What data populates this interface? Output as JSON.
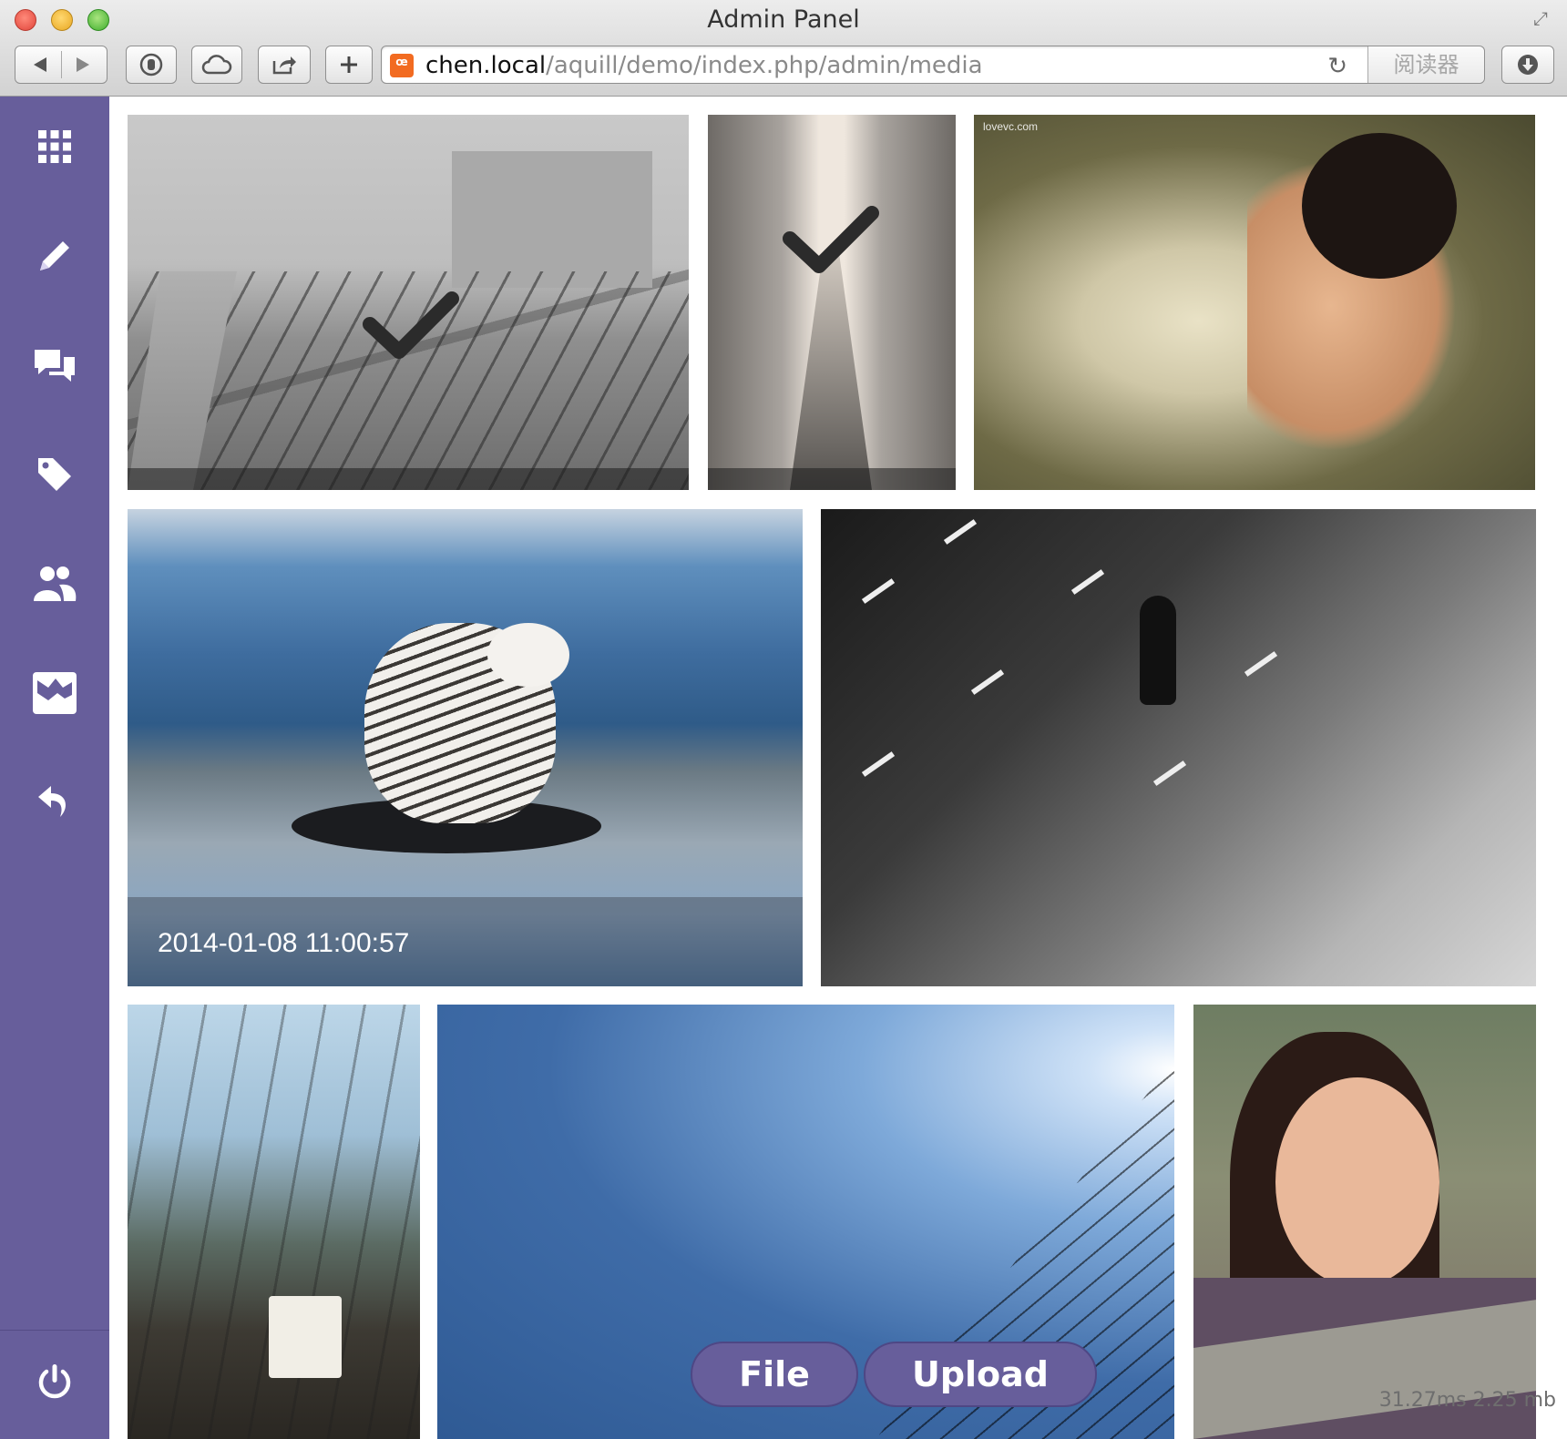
{
  "window": {
    "title": "Admin Panel"
  },
  "address_bar": {
    "host": "chen.local",
    "path": "/aquill/demo/index.php/admin/media",
    "reader_label": "阅读器"
  },
  "sidebar": {
    "items": [
      {
        "icon": "grid-icon"
      },
      {
        "icon": "pencil-icon"
      },
      {
        "icon": "comments-icon"
      },
      {
        "icon": "tag-icon"
      },
      {
        "icon": "users-icon"
      },
      {
        "icon": "media-icon"
      },
      {
        "icon": "undo-icon"
      }
    ],
    "logout_icon": "power-icon"
  },
  "media": {
    "tiles": [
      {
        "name": "media-tile-rail-yard",
        "selected": true
      },
      {
        "name": "media-tile-city-street",
        "selected": true
      },
      {
        "name": "media-tile-girl-sitting",
        "selected": false,
        "watermark": "lovevc.com"
      },
      {
        "name": "media-tile-snowy-owl",
        "selected": false,
        "caption": "2014-01-08 11:00:57"
      },
      {
        "name": "media-tile-road-walker",
        "selected": false
      },
      {
        "name": "media-tile-shopping-street",
        "selected": false
      },
      {
        "name": "media-tile-blue-sky",
        "selected": false
      },
      {
        "name": "media-tile-smiling-girl",
        "selected": false
      }
    ]
  },
  "actions": {
    "file_label": "File",
    "upload_label": "Upload"
  },
  "debug": {
    "time": "31.27ms",
    "memory": "2.25 mb"
  },
  "colors": {
    "sidebar": "#675e9b",
    "accent": "#675e9b"
  }
}
